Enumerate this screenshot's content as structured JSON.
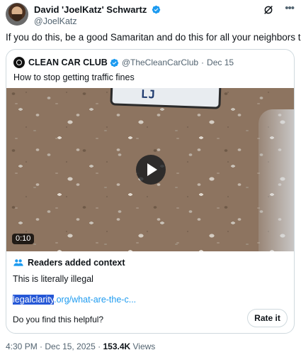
{
  "author": {
    "display_name": "David 'JoelKatz' Schwartz",
    "handle": "@JoelKatz"
  },
  "tweet_text": "If you do this, be a good Samaritan and do this for all your neighbors too.",
  "quoted": {
    "name": "CLEAN CAR CLUB",
    "handle": "@TheCleanCarClub",
    "separator": "·",
    "date": "Dec 15",
    "text": "How to stop getting traffic fines",
    "video": {
      "duration": "0:10",
      "plate_text": "LJ"
    }
  },
  "community_note": {
    "title": "Readers added context",
    "body": "This is literally illegal",
    "link_highlight": "legalclarity",
    "link_rest": ".org/what-are-the-c...",
    "helpful_prompt": "Do you find this helpful?",
    "rate_label": "Rate it"
  },
  "meta": {
    "time": "4:30 PM",
    "separator": "·",
    "date": "Dec 15, 2025",
    "views_count": "153.4K",
    "views_label": "Views"
  },
  "colors": {
    "verified": "#1d9bf0",
    "link": "#1d9bf0",
    "text_secondary": "#536471",
    "border": "#cfd9de"
  },
  "icons": [
    "verified-badge-icon",
    "grok-icon",
    "more-icon",
    "play-icon",
    "community-notes-icon"
  ]
}
